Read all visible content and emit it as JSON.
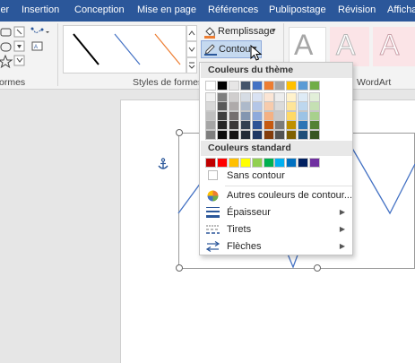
{
  "tabs": [
    "ier",
    "Insertion",
    "Conception",
    "Mise en page",
    "Références",
    "Publipostage",
    "Révision",
    "Affichage"
  ],
  "ribbon": {
    "group_shapes_label": "ormes",
    "group_styles_label": "Styles de formes",
    "group_wordart_label": "WordArt",
    "fill_button_label": "Remplissage",
    "outline_button_label": "Contour",
    "wordart_letter": "A"
  },
  "outline_menu": {
    "theme_colors_header": "Couleurs du thème",
    "standard_colors_header": "Couleurs standard",
    "no_outline_label": "Sans contour",
    "more_colors_label": "Autres couleurs de contour...",
    "weight_label": "Épaisseur",
    "dashes_label": "Tirets",
    "arrows_label": "Flèches",
    "theme_top_row": [
      "#ffffff",
      "#000000",
      "#e7e6e6",
      "#44546a",
      "#4472c4",
      "#ed7d31",
      "#a5a5a5",
      "#ffc000",
      "#5b9bd5",
      "#70ad47"
    ],
    "theme_shades": [
      [
        "#f2f2f2",
        "#7f7f7f",
        "#d0cece",
        "#d6dce4",
        "#d9e2f3",
        "#fbe5d5",
        "#ededed",
        "#fff2cc",
        "#deebf6",
        "#e2efd9"
      ],
      [
        "#d8d8d8",
        "#595959",
        "#aeaaaa",
        "#adb9ca",
        "#b4c6e7",
        "#f7cbac",
        "#dbdbdb",
        "#fee599",
        "#bdd7ee",
        "#c5e0b3"
      ],
      [
        "#bfbfbf",
        "#3f3f3f",
        "#757070",
        "#8496b0",
        "#8eaadb",
        "#f4b183",
        "#c9c9c9",
        "#ffd965",
        "#9cc3e5",
        "#a8d08d"
      ],
      [
        "#a5a5a5",
        "#262626",
        "#3a3838",
        "#323f4f",
        "#2f5496",
        "#c55a11",
        "#7b7b7b",
        "#bf9000",
        "#2e75b5",
        "#538135"
      ],
      [
        "#7f7f7f",
        "#0c0c0c",
        "#171616",
        "#222a35",
        "#1f3864",
        "#833c0b",
        "#525252",
        "#7f6000",
        "#1e4e79",
        "#375623"
      ]
    ],
    "standard_colors": [
      "#c00000",
      "#ff0000",
      "#ffc000",
      "#ffff00",
      "#92d050",
      "#00b050",
      "#00b0f0",
      "#0070c0",
      "#002060",
      "#7030a0"
    ]
  }
}
